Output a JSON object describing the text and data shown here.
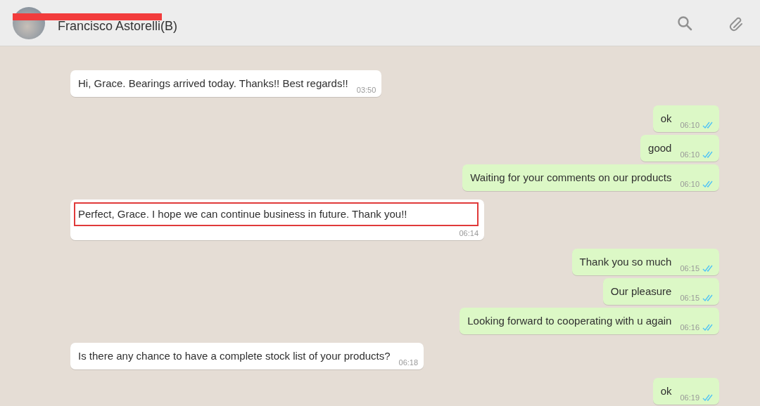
{
  "header": {
    "contact_name": "Francisco Astorelli(B)",
    "redacted": true
  },
  "messages": [
    {
      "kind": "received",
      "text": "Hi, Grace. Bearings arrived today. Thanks!! Best regards!!",
      "time": "03:50",
      "highlighted": false
    },
    {
      "kind": "sent",
      "text": "ok",
      "time": "06:10",
      "read": true
    },
    {
      "kind": "sent",
      "text": "good",
      "time": "06:10",
      "read": true
    },
    {
      "kind": "sent",
      "text": "Waiting for your comments on our products",
      "time": "06:10",
      "read": true
    },
    {
      "kind": "received",
      "text": "Perfect, Grace. I hope we can continue business in future. Thank you!!",
      "time": "06:14",
      "highlighted": true
    },
    {
      "kind": "sent",
      "text": "Thank you so much",
      "time": "06:15",
      "read": true
    },
    {
      "kind": "sent",
      "text": "Our pleasure",
      "time": "06:15",
      "read": true
    },
    {
      "kind": "sent",
      "text": "Looking forward to cooperating with u again",
      "time": "06:16",
      "read": true
    },
    {
      "kind": "received",
      "text": "Is there any chance to have a  complete stock list of your products?",
      "time": "06:18",
      "highlighted": false
    },
    {
      "kind": "sent",
      "text": "ok",
      "time": "06:19",
      "read": true
    }
  ]
}
